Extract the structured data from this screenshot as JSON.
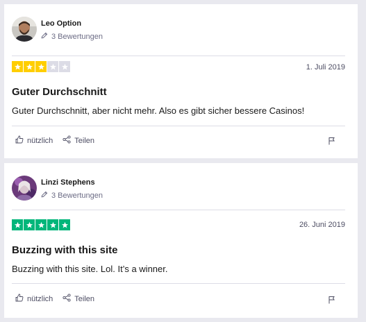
{
  "reviews": [
    {
      "name": "Leo Option",
      "review_count": "3 Bewertungen",
      "rating": 3,
      "max_rating": 5,
      "star_color": "#ffce00",
      "date": "1. Juli 2019",
      "title": "Guter Durchschnitt",
      "body": "Guter Durchschnitt, aber nicht mehr. Also es gibt sicher bessere Casinos!",
      "useful_label": "nützlich",
      "share_label": "Teilen"
    },
    {
      "name": "Linzi Stephens",
      "review_count": "3 Bewertungen",
      "rating": 5,
      "max_rating": 5,
      "star_color": "#00b67a",
      "date": "26. Juni 2019",
      "title": "Buzzing with this site",
      "body": "Buzzing with this site. Lol. It’s a winner.",
      "useful_label": "nützlich",
      "share_label": "Teilen"
    }
  ],
  "colors": {
    "page_background": "#e9e9ef",
    "star_empty": "#dcdce6",
    "muted_text": "#6c6c85"
  },
  "icons": [
    "pencil-icon",
    "thumbs-up-icon",
    "share-icon",
    "flag-icon",
    "star-icon"
  ]
}
